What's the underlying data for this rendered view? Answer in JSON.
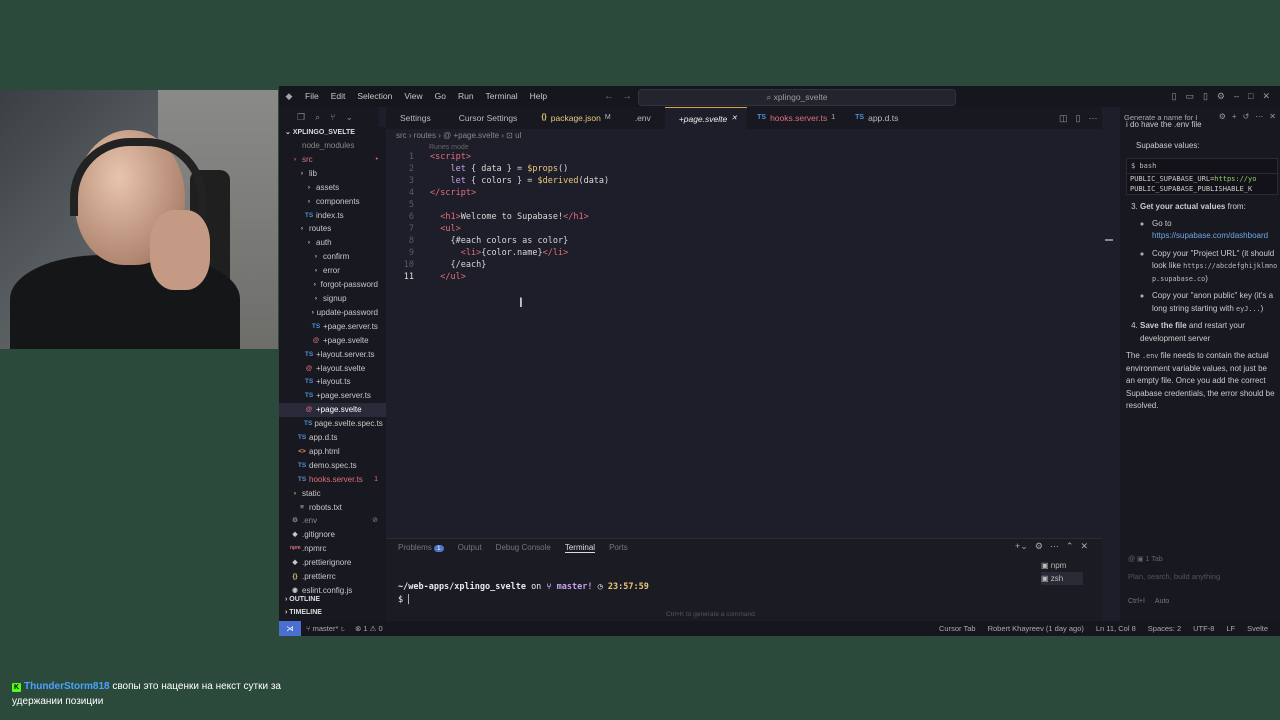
{
  "menu": [
    "File",
    "Edit",
    "Selection",
    "View",
    "Go",
    "Run",
    "Terminal",
    "Help"
  ],
  "command_center": "xplingo_svelte",
  "tabs": [
    {
      "icon": "",
      "label": "Settings",
      "extra": ""
    },
    {
      "icon": "",
      "label": "Cursor Settings",
      "extra": ""
    },
    {
      "icon": "{}",
      "label": "package.json",
      "extra": "M"
    },
    {
      "icon": "",
      "label": ".env",
      "extra": ""
    },
    {
      "icon": "",
      "label": "+page.svelte",
      "extra": "✕"
    },
    {
      "icon": "TS",
      "label": "hooks.server.ts",
      "extra": "1"
    },
    {
      "icon": "TS",
      "label": "app.d.ts",
      "extra": ""
    }
  ],
  "sidebar": {
    "root": "XPLINGO_SVELTE",
    "items": [
      {
        "label": "node_modules",
        "icon": "",
        "indent": 1,
        "color": "#888",
        "badge": ""
      },
      {
        "label": "src",
        "icon": "›",
        "indent": 1,
        "color": "#e0707b",
        "badge": "•"
      },
      {
        "label": "lib",
        "icon": "›",
        "indent": 2,
        "color": "#c8c8c8",
        "badge": ""
      },
      {
        "label": "assets",
        "icon": "›",
        "indent": 3,
        "color": "#c8c8c8",
        "badge": ""
      },
      {
        "label": "components",
        "icon": "›",
        "indent": 3,
        "color": "#c8c8c8",
        "badge": ""
      },
      {
        "label": "index.ts",
        "icon": "TS",
        "indent": 3,
        "color": "#c8c8c8",
        "badge": ""
      },
      {
        "label": "routes",
        "icon": "›",
        "indent": 2,
        "color": "#c8c8c8",
        "badge": ""
      },
      {
        "label": "auth",
        "icon": "›",
        "indent": 3,
        "color": "#c8c8c8",
        "badge": ""
      },
      {
        "label": "confirm",
        "icon": "›",
        "indent": 4,
        "color": "#c8c8c8",
        "badge": ""
      },
      {
        "label": "error",
        "icon": "›",
        "indent": 4,
        "color": "#c8c8c8",
        "badge": ""
      },
      {
        "label": "forgot-password",
        "icon": "›",
        "indent": 4,
        "color": "#c8c8c8",
        "badge": ""
      },
      {
        "label": "signup",
        "icon": "›",
        "indent": 4,
        "color": "#c8c8c8",
        "badge": ""
      },
      {
        "label": "update-password",
        "icon": "›",
        "indent": 4,
        "color": "#c8c8c8",
        "badge": ""
      },
      {
        "label": "+page.server.ts",
        "icon": "TS",
        "indent": 4,
        "color": "#c8c8c8",
        "badge": ""
      },
      {
        "label": "+page.svelte",
        "icon": "@",
        "indent": 4,
        "color": "#c8c8c8",
        "badge": ""
      },
      {
        "label": "+layout.server.ts",
        "icon": "TS",
        "indent": 3,
        "color": "#c8c8c8",
        "badge": ""
      },
      {
        "label": "+layout.svelte",
        "icon": "@",
        "indent": 3,
        "color": "#c8c8c8",
        "badge": ""
      },
      {
        "label": "+layout.ts",
        "icon": "TS",
        "indent": 3,
        "color": "#c8c8c8",
        "badge": ""
      },
      {
        "label": "+page.server.ts",
        "icon": "TS",
        "indent": 3,
        "color": "#c8c8c8",
        "badge": ""
      },
      {
        "label": "+page.svelte",
        "icon": "@",
        "indent": 3,
        "color": "#ffffff",
        "badge": ""
      },
      {
        "label": "page.svelte.spec.ts",
        "icon": "TS",
        "indent": 3,
        "color": "#c8c8c8",
        "badge": ""
      },
      {
        "label": "app.d.ts",
        "icon": "TS",
        "indent": 2,
        "color": "#c8c8c8",
        "badge": ""
      },
      {
        "label": "app.html",
        "icon": "<>",
        "indent": 2,
        "color": "#c8c8c8",
        "badge": ""
      },
      {
        "label": "demo.spec.ts",
        "icon": "TS",
        "indent": 2,
        "color": "#c8c8c8",
        "badge": ""
      },
      {
        "label": "hooks.server.ts",
        "icon": "TS",
        "indent": 2,
        "color": "#e0707b",
        "badge": "1"
      },
      {
        "label": "static",
        "icon": "›",
        "indent": 1,
        "color": "#c8c8c8",
        "badge": ""
      },
      {
        "label": "robots.txt",
        "icon": "≡",
        "indent": 2,
        "color": "#c8c8c8",
        "badge": ""
      },
      {
        "label": ".env",
        "icon": "⚙",
        "indent": 1,
        "color": "#888",
        "badge": "⊘"
      },
      {
        "label": ".gitignore",
        "icon": "◆",
        "indent": 1,
        "color": "#c8c8c8",
        "badge": ""
      },
      {
        "label": ".npmrc",
        "icon": "npm",
        "indent": 1,
        "color": "#c8c8c8",
        "badge": ""
      },
      {
        "label": ".prettierignore",
        "icon": "◆",
        "indent": 1,
        "color": "#c8c8c8",
        "badge": ""
      },
      {
        "label": ".prettierrc",
        "icon": "{}",
        "indent": 1,
        "color": "#c8c8c8",
        "badge": ""
      },
      {
        "label": "eslint.config.js",
        "icon": "◉",
        "indent": 1,
        "color": "#c8c8c8",
        "badge": ""
      }
    ],
    "outline": "OUTLINE",
    "timeline": "TIMELINE"
  },
  "breadcrumb": "src › routes › @ +page.svelte › ⊡ ul",
  "hint": "Runes mode",
  "code": [
    {
      "n": "1",
      "html": "<span class='tag'>&lt;script&gt;</span>"
    },
    {
      "n": "2",
      "html": "    <span class='kw'>let</span> <span class='var'>{ data } = </span><span class='fn'>$props</span><span class='var'>()</span>"
    },
    {
      "n": "3",
      "html": "    <span class='kw'>let</span> <span class='var'>{ colors } = </span><span class='fn'>$derived</span><span class='var'>(data)</span>"
    },
    {
      "n": "4",
      "html": "<span class='tag'>&lt;/script&gt;</span>"
    },
    {
      "n": "5",
      "html": ""
    },
    {
      "n": "6",
      "html": "  <span class='tag'>&lt;h1&gt;</span><span class='var'>Welcome to Supabase!</span><span class='tag'>&lt;/h1&gt;</span>"
    },
    {
      "n": "7",
      "html": "  <span class='tag'>&lt;ul&gt;</span>"
    },
    {
      "n": "8",
      "html": "    <span class='var'>{#each colors as color}</span>"
    },
    {
      "n": "9",
      "html": "      <span class='tag'>&lt;li&gt;</span><span class='var'>{color.name}</span><span class='tag'>&lt;/li&gt;</span>"
    },
    {
      "n": "10",
      "html": "    <span class='var'>{/each}</span>"
    },
    {
      "n": "11",
      "html": "  <span class='tag'>&lt;/ul&gt;</span>"
    }
  ],
  "panel": {
    "tabs": [
      "Problems",
      "Output",
      "Debug Console",
      "Terminal",
      "Ports"
    ],
    "problems_count": "1",
    "prompt_path": "~/web-apps/xplingo_svelte",
    "prompt_on": "on",
    "prompt_branch": "master!",
    "prompt_time": "23:57:59",
    "prompt_line2": "$ ▏",
    "hint": "Ctrl+K to generate a command",
    "terminals": [
      "npm",
      "zsh"
    ]
  },
  "chat": {
    "title": "Generate a name for I",
    "user_msg": "i do have the .env file",
    "supabase_values": "Supabase values:",
    "code_header": "$ bash",
    "code_line1_key": "PUBLIC_SUPABASE_URL=",
    "code_line1_val": "https://yo",
    "code_line2": "PUBLIC_SUPABASE_PUBLISHABLE_K",
    "step3_bold": "Get your actual values",
    "step3_rest": " from:",
    "goto": "Go to",
    "goto_link": "https://supabase.com/dashboard",
    "copy_url": "Copy your \"Project URL\" (it should look like ",
    "copy_url_code": "https://abcdefghijklmnop.supabase.co",
    "copy_url_end": ")",
    "copy_key": "Copy your \"anon public\" key (it's a long string starting with ",
    "copy_key_code": "eyJ...",
    "copy_key_end": ")",
    "step4_bold": "Save the file",
    "step4_rest": " and restart your development server",
    "para_a": "The ",
    "para_code": ".env",
    "para_b": " file needs to contain the actual environment variable values, not just be an empty file. Once you add the correct Supabase credentials, the error should be resolved.",
    "tab_count": "1 Tab",
    "placeholder": "Plan, search, build anything",
    "mode": "Ctrl+I",
    "model": "Auto"
  },
  "status": {
    "branch": "master*",
    "errors": "⊗ 1 ⚠ 0",
    "right": [
      "Cursor Tab",
      "Robert Khayreev (1 day ago)",
      "Ln 11, Col 8",
      "Spaces: 2",
      "UTF-8",
      "LF",
      "Svelte"
    ]
  },
  "stream_chat": {
    "user": "ThunderStorm818",
    "message": "свопы это наценки на некст сутки за удержании позиции"
  }
}
